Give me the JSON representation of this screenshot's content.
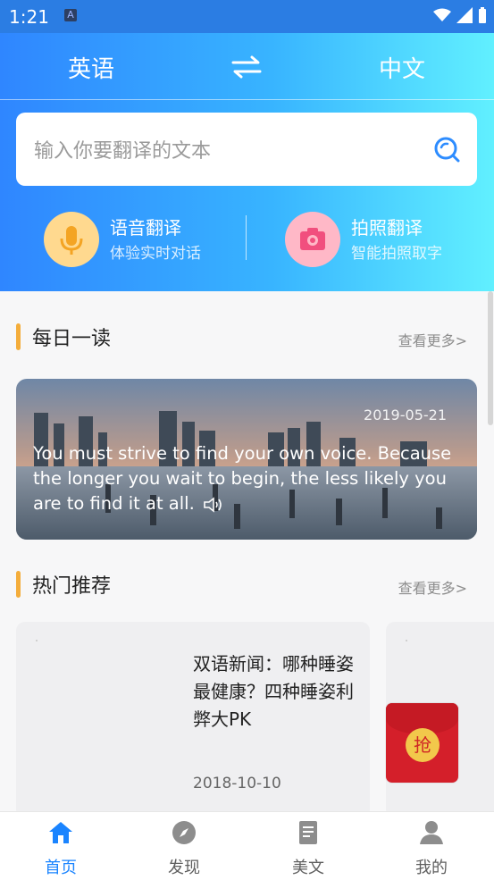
{
  "status_bar": {
    "time": "1:21",
    "indicator": "A",
    "icons": [
      "wifi-icon",
      "signal-icon",
      "battery-icon"
    ]
  },
  "header": {
    "source_language": "英语",
    "target_language": "中文",
    "swap_icon": "swap-icon"
  },
  "search": {
    "placeholder": "输入你要翻译的文本",
    "value": "",
    "icon": "search-icon"
  },
  "tools": [
    {
      "title": "语音翻译",
      "subtitle": "体验实时对话",
      "icon": "microphone-icon",
      "color": "#ffd98f"
    },
    {
      "title": "拍照翻译",
      "subtitle": "智能拍照取字",
      "icon": "camera-icon",
      "color": "#ffb8c7"
    }
  ],
  "daily_read": {
    "section_title": "每日一读",
    "more_label": "查看更多>",
    "date": "2019-05-21",
    "quote": "You must strive to find your own voice. Because the longer you wait to begin, the less likely you are to find it at all."
  },
  "recommend": {
    "section_title": "热门推荐",
    "more_label": "查看更多>",
    "items": [
      {
        "title": "双语新闻：哪种睡姿最健康？四种睡姿利弊大PK",
        "date": "2018-10-10"
      }
    ]
  },
  "red_packet": {
    "label": "抢"
  },
  "bottom_nav": [
    {
      "label": "首页",
      "icon": "home-icon",
      "active": true
    },
    {
      "label": "发现",
      "icon": "compass-icon",
      "active": false
    },
    {
      "label": "美文",
      "icon": "article-icon",
      "active": false
    },
    {
      "label": "我的",
      "icon": "profile-icon",
      "active": false
    }
  ],
  "colors": {
    "accent": "#1a84ff",
    "header_gradient_start": "#2f86ff",
    "header_gradient_end": "#61f0ff",
    "section_bar": "#f4ad3b"
  }
}
